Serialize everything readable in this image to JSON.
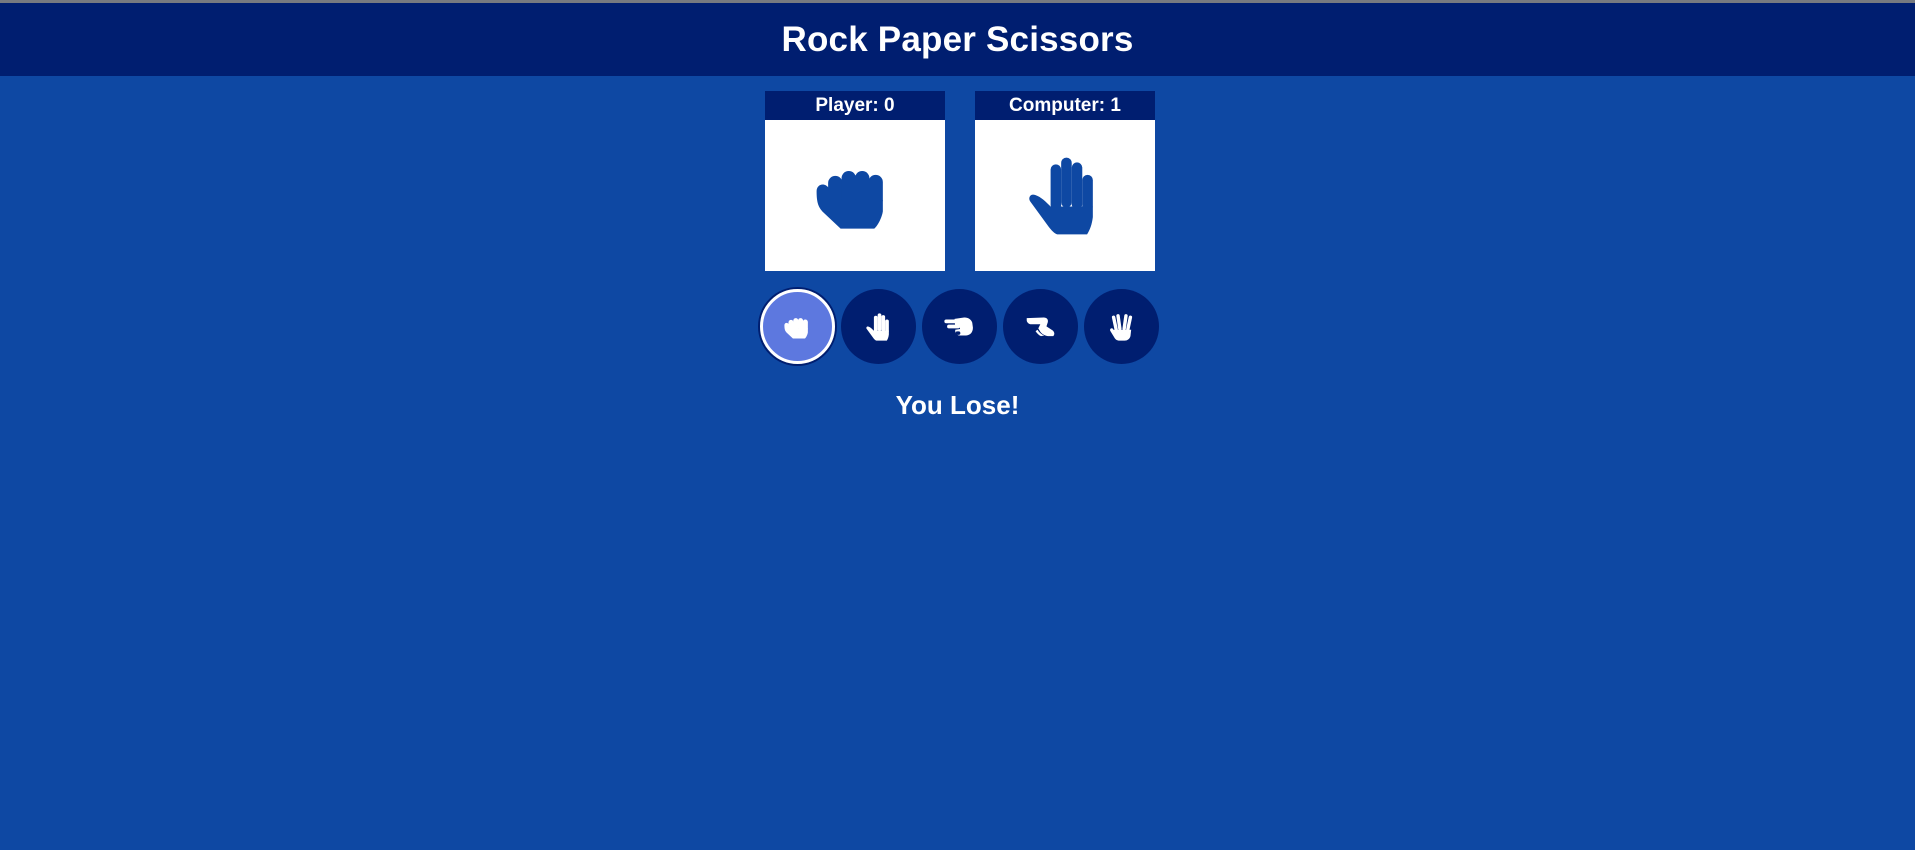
{
  "header": {
    "title": "Rock Paper Scissors"
  },
  "scoreboard": {
    "player_label": "Player: 0",
    "computer_label": "Computer: 1",
    "player_choice_icon": "rock-icon",
    "computer_choice_icon": "paper-icon"
  },
  "choices": [
    {
      "name": "rock",
      "icon": "rock-icon",
      "selected": true
    },
    {
      "name": "paper",
      "icon": "paper-icon",
      "selected": false
    },
    {
      "name": "scissors",
      "icon": "scissors-icon",
      "selected": false
    },
    {
      "name": "lizard",
      "icon": "lizard-icon",
      "selected": false
    },
    {
      "name": "spock",
      "icon": "spock-icon",
      "selected": false
    }
  ],
  "result": {
    "text": "You Lose!"
  },
  "colors": {
    "background": "#0e48a3",
    "header_background": "#001e70",
    "button_background": "#001e70",
    "selected_button_background": "#5d78df",
    "card_background": "#ffffff",
    "icon_in_card": "#0e48a3",
    "text": "#ffffff"
  }
}
